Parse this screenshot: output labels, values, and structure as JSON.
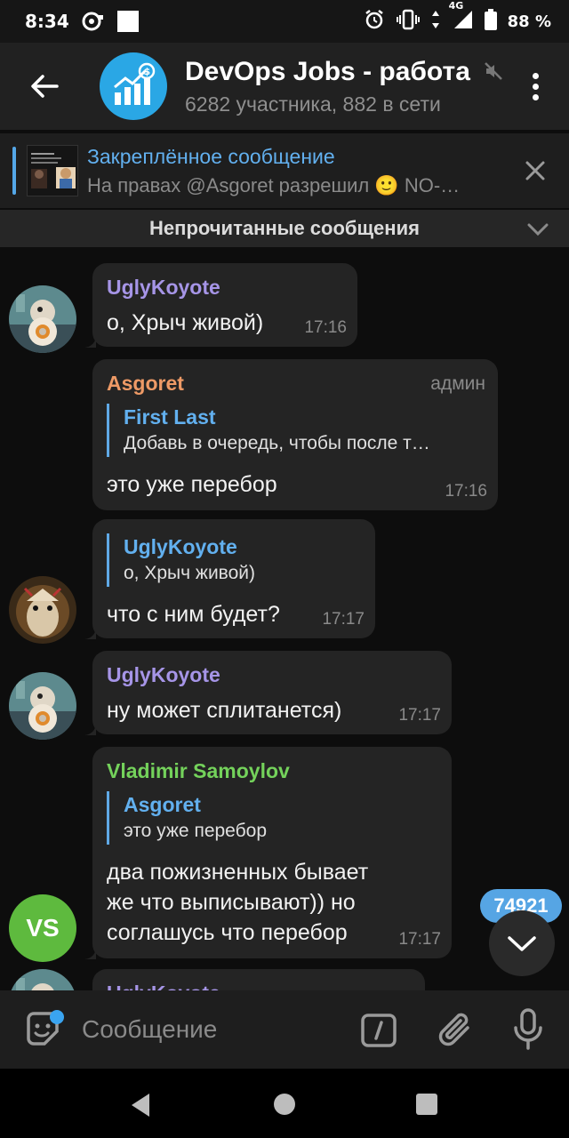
{
  "status_bar": {
    "time": "8:34",
    "network": "4G",
    "battery": "88 %"
  },
  "header": {
    "title": "DevOps Jobs - работа",
    "subtitle": "6282 участника, 882 в сети",
    "icons": [
      "back-arrow-icon",
      "chart-dollar-icon",
      "muted-icon",
      "more-vert-icon"
    ]
  },
  "pinned": {
    "title": "Закреплённое сообщение",
    "preview": "На правах @Asgoret разрешил 🙂 NO-…"
  },
  "unread_divider": {
    "label": "Непрочитанные сообщения"
  },
  "messages": [
    {
      "sender": "UglyKoyote",
      "sender_color": "#a695e7",
      "text": "о, Хрыч живой)",
      "time": "17:16"
    },
    {
      "sender": "Asgoret",
      "sender_color": "#ee9a66",
      "role": "админ",
      "reply_name": "First Last",
      "reply_text": "Добавь в очередь, чтобы после т…",
      "text": "это уже перебор",
      "time": "17:16"
    },
    {
      "reply_name": "UglyKoyote",
      "reply_text": "о, Хрыч живой)",
      "text": "что с ним будет?",
      "time": "17:17"
    },
    {
      "sender": "UglyKoyote",
      "sender_color": "#a695e7",
      "text": "ну может сплитанется)",
      "time": "17:17"
    },
    {
      "sender": "Vladimir Samoylov",
      "sender_color": "#74d25b",
      "reply_name": "Asgoret",
      "reply_text": "это уже перебор",
      "text_lines": [
        "два пожизненных бывает",
        "же что выписывают)) но",
        "соглашусь что перебор"
      ],
      "time": "17:17",
      "avatar_initials": "VS"
    },
    {
      "sender": "UglyKoyote",
      "sender_color": "#a695e7"
    }
  ],
  "unread_count": "74921",
  "input": {
    "placeholder": "Сообщение"
  },
  "colors": {
    "accent": "#54a7e8",
    "bubble": "#242424",
    "background": "#0d0d0d"
  }
}
